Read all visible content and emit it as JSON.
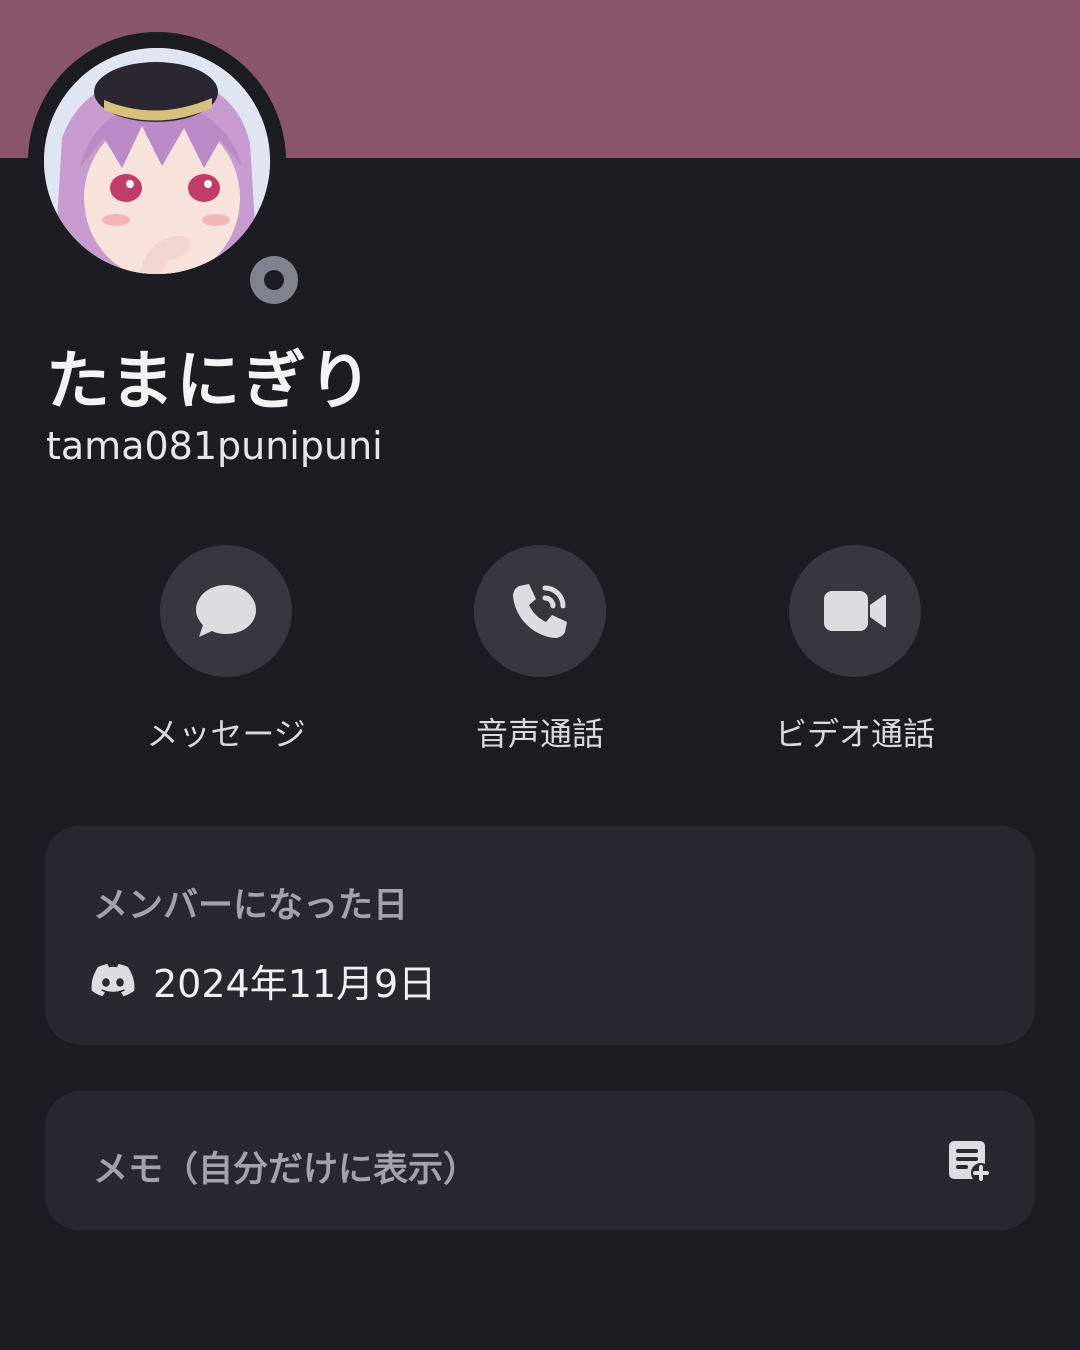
{
  "profile": {
    "display_name": "たまにぎり",
    "username": "tama081punipuni",
    "status": "offline"
  },
  "actions": [
    {
      "label": "メッセージ",
      "icon": "chat-bubble-icon"
    },
    {
      "label": "音声通話",
      "icon": "phone-call-icon"
    },
    {
      "label": "ビデオ通話",
      "icon": "video-camera-icon"
    }
  ],
  "member_since": {
    "title": "メンバーになった日",
    "icon": "discord-icon",
    "date": "2024年11月9日"
  },
  "note": {
    "label": "メモ（自分だけに表示）",
    "icon": "add-note-icon"
  },
  "colors": {
    "banner": "#8a566c",
    "background": "#1c1d22",
    "card": "#272830",
    "action_circle": "#36373f",
    "status_offline": "#80848e"
  }
}
